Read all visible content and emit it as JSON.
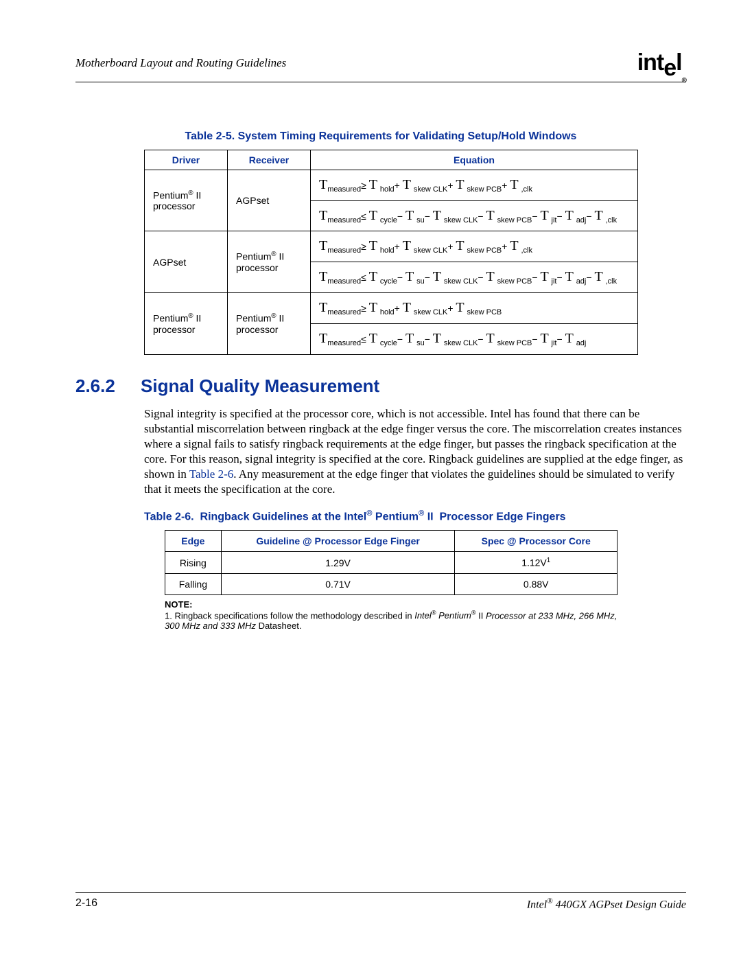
{
  "header": {
    "section_title": "Motherboard Layout and Routing Guidelines",
    "logo_text": "intel",
    "logo_reg": "®"
  },
  "table5": {
    "caption": "Table 2-5. System Timing Requirements for Validating Setup/Hold Windows",
    "headers": {
      "driver": "Driver",
      "receiver": "Receiver",
      "equation": "Equation"
    },
    "rows": [
      {
        "driver": "Pentium® II processor",
        "receiver": "AGPset",
        "eq1": {
          "lhs_sub": "measured",
          "rel": "≥",
          "terms": [
            "hold",
            "skew CLK",
            "skew PCB",
            ",clk"
          ],
          "ops": [
            "+",
            "+",
            "+",
            ""
          ]
        },
        "eq2": {
          "lhs_sub": "measured",
          "rel": "≤",
          "terms": [
            "cycle",
            "su",
            "skew CLK",
            "skew PCB",
            "jit",
            "adj",
            ",clk"
          ],
          "ops": [
            "−",
            "−",
            "−",
            "−",
            "−",
            "−",
            ""
          ]
        }
      },
      {
        "driver": "AGPset",
        "receiver": "Pentium® II processor",
        "eq1": {
          "lhs_sub": "measured",
          "rel": "≥",
          "terms": [
            "hold",
            "skew CLK",
            "skew PCB",
            ",clk"
          ],
          "ops": [
            "+",
            "+",
            "+",
            ""
          ]
        },
        "eq2": {
          "lhs_sub": "measured",
          "rel": "≤",
          "terms": [
            "cycle",
            "su",
            "skew CLK",
            "skew PCB",
            "jit",
            "adj",
            ",clk"
          ],
          "ops": [
            "−",
            "−",
            "−",
            "−",
            "−",
            "−",
            ""
          ]
        }
      },
      {
        "driver": "Pentium® II processor",
        "receiver": "Pentium® II processor",
        "eq1": {
          "lhs_sub": "measured",
          "rel": "≥",
          "terms": [
            "hold",
            "skew CLK",
            "skew PCB"
          ],
          "ops": [
            "+",
            "+",
            ""
          ]
        },
        "eq2": {
          "lhs_sub": "measured",
          "rel": "≤",
          "terms": [
            "cycle",
            "su",
            "skew CLK",
            "skew PCB",
            "jit",
            "adj"
          ],
          "ops": [
            "−",
            "−",
            "−",
            "−",
            "−",
            ""
          ]
        }
      }
    ]
  },
  "section": {
    "number": "2.6.2",
    "title": "Signal Quality Measurement",
    "para_before_link": "Signal integrity is specified at the processor core, which is not accessible. Intel has found that there can be substantial miscorrelation between ringback at the edge finger versus the core. The miscorrelation creates instances where a signal fails to satisfy ringback requirements at the edge finger, but passes the ringback specification at the core. For this reason, signal integrity is specified at the core. Ringback guidelines are supplied at the edge finger, as shown in ",
    "link_text": "Table 2-6",
    "para_after_link": ". Any measurement at the edge finger that violates the guidelines should be simulated to verify that it meets the specification at the core."
  },
  "table6": {
    "caption": "Table 2-6.  Ringback Guidelines at the Intel® Pentium® II  Processor Edge Fingers",
    "headers": {
      "edge": "Edge",
      "guideline": "Guideline @ Processor Edge Finger",
      "spec": "Spec @ Processor Core"
    },
    "rows": [
      {
        "edge": "Rising",
        "guideline": "1.29V",
        "spec": "1.12V",
        "spec_sup": "1"
      },
      {
        "edge": "Falling",
        "guideline": "0.71V",
        "spec": "0.88V",
        "spec_sup": ""
      }
    ]
  },
  "note": {
    "heading": "NOTE:",
    "item": "1. Ringback specifications follow the methodology described in Intel® Pentium® II Processor at 233 MHz, 266 MHz, 300 MHz and 333 MHz Datasheet."
  },
  "footer": {
    "page": "2-16",
    "doc": "Intel® 440GX AGPset Design Guide"
  }
}
